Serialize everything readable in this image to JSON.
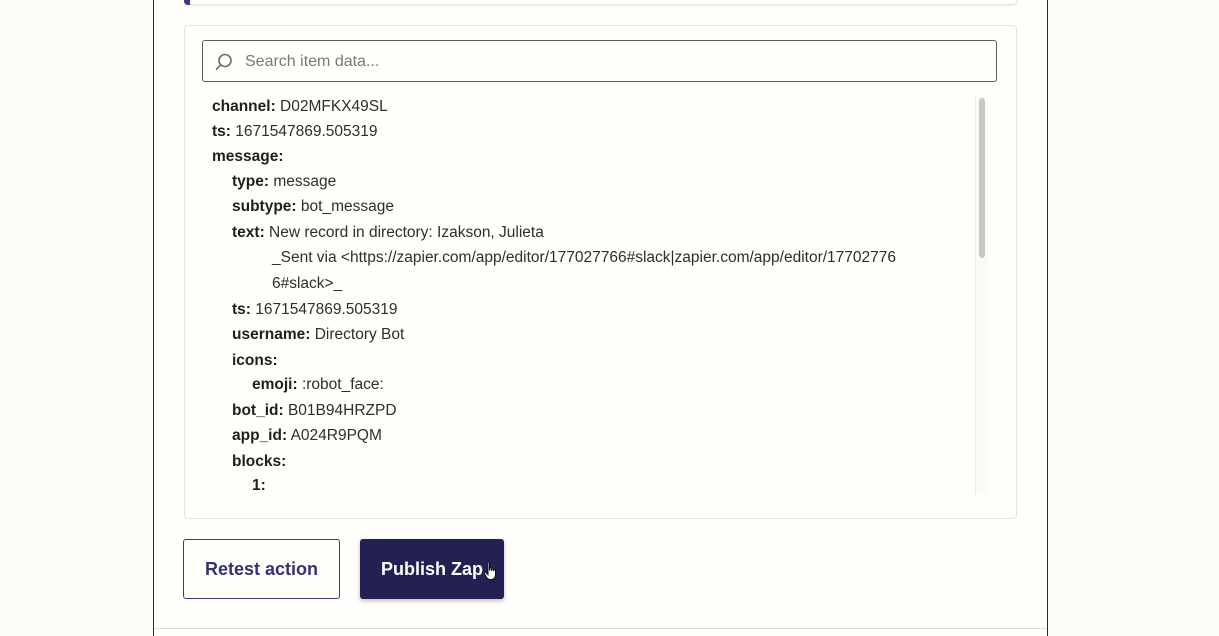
{
  "search": {
    "placeholder": "Search item data...",
    "value": ""
  },
  "tree": {
    "rows": [
      {
        "key": "channel:",
        "value": "D02MFKX49SL"
      },
      {
        "key": "ts:",
        "value": "1671547869.505319"
      },
      {
        "key": "message:",
        "value": ""
      },
      {
        "key": "type:",
        "value": "message"
      },
      {
        "key": "subtype:",
        "value": "bot_message"
      },
      {
        "key": "text:",
        "value": "New record in directory: Izakson, Julieta"
      },
      {
        "key": "",
        "value": "_Sent via <https://zapier.com/app/editor/177027766#slack|zapier.com/app/editor/17702776"
      },
      {
        "key": "",
        "value": "6#slack>_"
      },
      {
        "key": "ts:",
        "value": "1671547869.505319"
      },
      {
        "key": "username:",
        "value": "Directory Bot"
      },
      {
        "key": "icons:",
        "value": ""
      },
      {
        "key": "emoji:",
        "value": ":robot_face:"
      },
      {
        "key": "bot_id:",
        "value": "B01B94HRZPD"
      },
      {
        "key": "app_id:",
        "value": "A024R9PQM"
      },
      {
        "key": "blocks:",
        "value": ""
      },
      {
        "key": "1:",
        "value": ""
      }
    ]
  },
  "actions": {
    "retest_label": "Retest action",
    "publish_label": "Publish Zap"
  },
  "icons": {
    "search": "search-icon",
    "cursor": "hand-pointer-cursor"
  },
  "colors": {
    "accent": "#3d3a8a",
    "publish_bg": "#222151",
    "retest_text": "#333272"
  }
}
